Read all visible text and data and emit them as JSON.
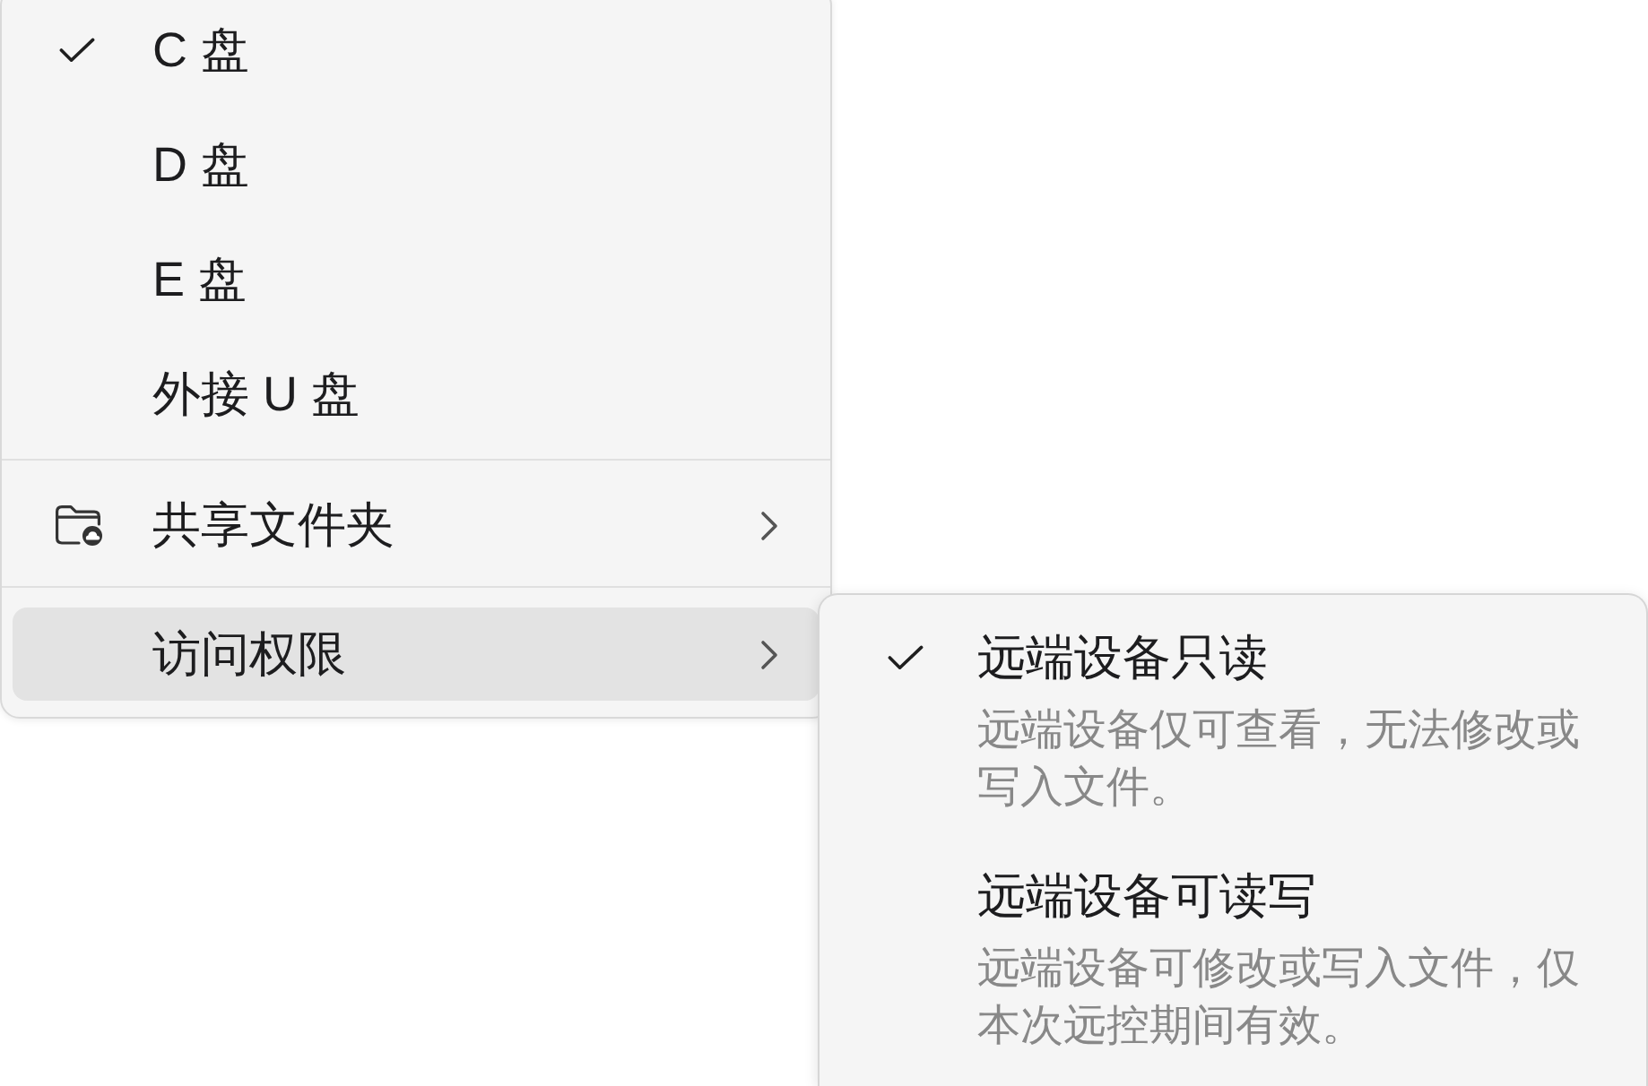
{
  "menu": {
    "sections": [
      {
        "items": [
          {
            "kind": "option",
            "label": "C 盘",
            "checked": true
          },
          {
            "kind": "option",
            "label": "D 盘",
            "checked": false
          },
          {
            "kind": "option",
            "label": "E 盘",
            "checked": false
          },
          {
            "kind": "option",
            "label": "外接 U 盘",
            "checked": false
          }
        ]
      },
      {
        "items": [
          {
            "kind": "folder",
            "label": "共享文件夹",
            "expanded": false
          }
        ]
      },
      {
        "items": [
          {
            "kind": "submenu",
            "label": "访问权限",
            "expanded": true
          }
        ]
      }
    ]
  },
  "submenu": {
    "items": [
      {
        "title": "远端设备只读",
        "description": "远端设备仅可查看，无法修改或写入文件。",
        "checked": true
      },
      {
        "title": "远端设备可读写",
        "description": "远端设备可修改或写入文件，仅本次远控期间有效。",
        "checked": false
      }
    ]
  }
}
